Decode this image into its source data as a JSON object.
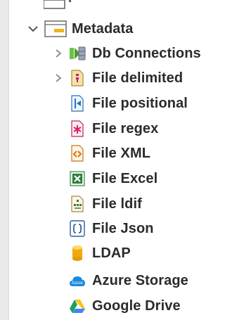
{
  "tree": {
    "metadata": {
      "label": "Metadata",
      "children": [
        {
          "label": "Db Connections",
          "icon": "db-connections-icon"
        },
        {
          "label": "File delimited",
          "icon": "file-delimited-icon"
        },
        {
          "label": "File positional",
          "icon": "file-positional-icon"
        },
        {
          "label": "File regex",
          "icon": "file-regex-icon"
        },
        {
          "label": "File XML",
          "icon": "file-xml-icon"
        },
        {
          "label": "File Excel",
          "icon": "file-excel-icon"
        },
        {
          "label": "File ldif",
          "icon": "file-ldif-icon"
        },
        {
          "label": "File Json",
          "icon": "file-json-icon"
        },
        {
          "label": "LDAP",
          "icon": "ldap-icon"
        },
        {
          "label": "Azure Storage",
          "icon": "azure-storage-icon"
        },
        {
          "label": "Google Drive",
          "icon": "google-drive-icon"
        }
      ]
    }
  },
  "colors": {
    "text": "#2b2b2b",
    "arrow": "#7a7a7a",
    "sidebar": "#eaeaea"
  }
}
